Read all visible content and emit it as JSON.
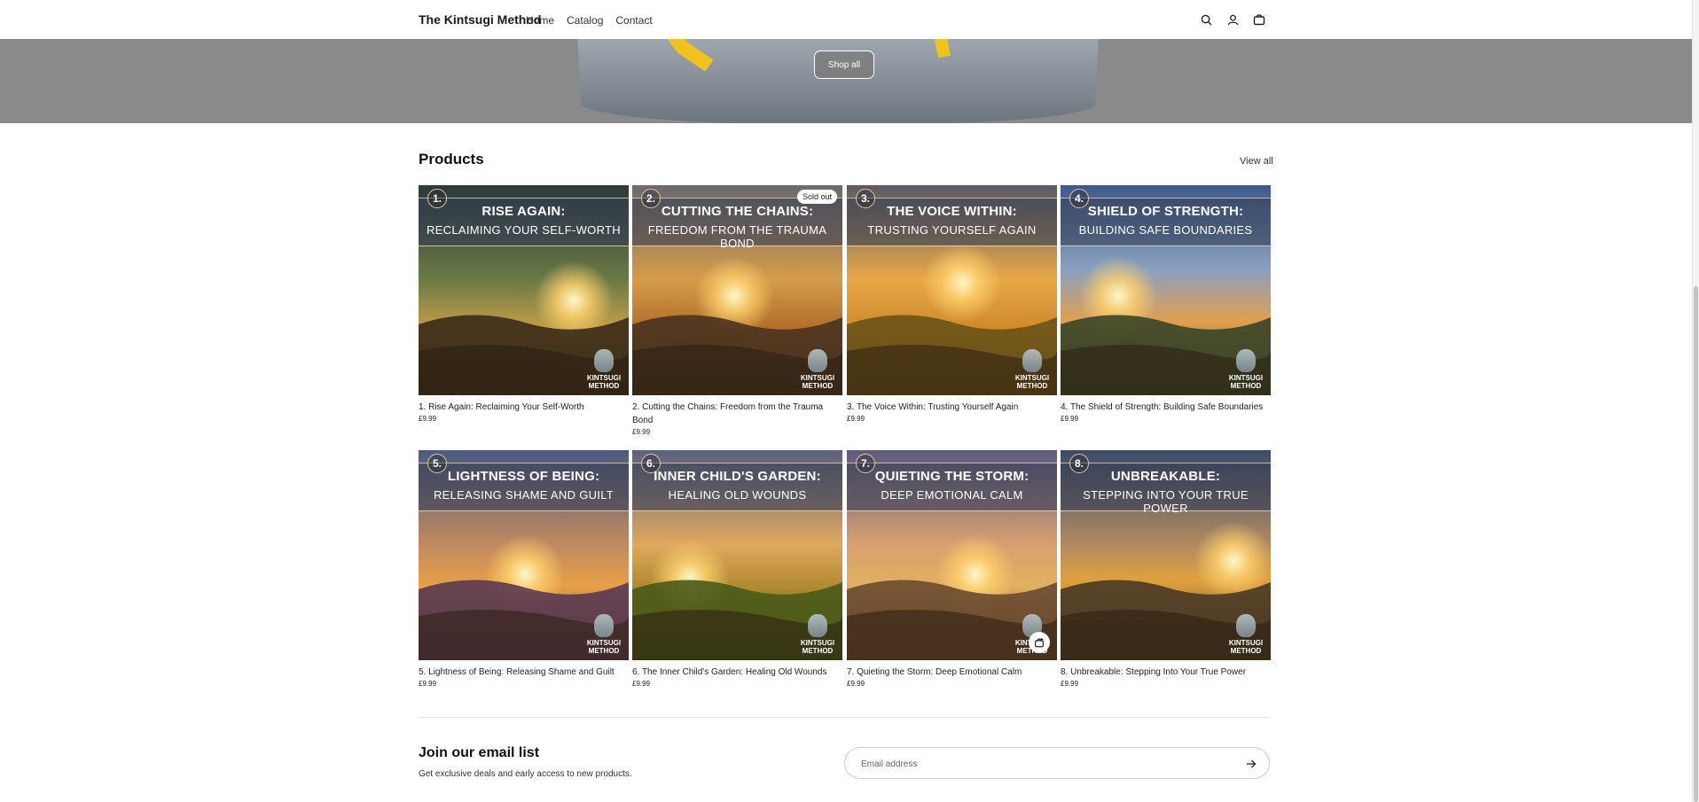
{
  "header": {
    "brand": "The Kintsugi Method",
    "nav": [
      "Home",
      "Catalog",
      "Contact"
    ]
  },
  "hero": {
    "button_label": "Shop all"
  },
  "products": {
    "title": "Products",
    "view_all": "View all",
    "logo_text": [
      "KINTSUGI",
      "METHOD"
    ],
    "items": [
      {
        "num": "1.",
        "line1": "RISE AGAIN:",
        "line2": "RECLAIMING YOUR SELF-WORTH",
        "title": "1. Rise Again: Reclaiming Your Self-Worth",
        "price": "£9.99",
        "badge": ""
      },
      {
        "num": "2.",
        "line1": "CUTTING THE CHAINS:",
        "line2": "FREEDOM FROM THE TRAUMA BOND",
        "title": "2. Cutting the Chains: Freedom from the Trauma Bond",
        "price": "£9.99",
        "badge": "Sold out"
      },
      {
        "num": "3.",
        "line1": "THE VOICE WITHIN:",
        "line2": "TRUSTING YOURSELF AGAIN",
        "title": "3. The Voice Within: Trusting Yourself Again",
        "price": "£9.99",
        "badge": ""
      },
      {
        "num": "4.",
        "line1": "SHIELD OF STRENGTH:",
        "line2": "BUILDING SAFE BOUNDARIES",
        "title": "4. The Shield of Strength: Building Safe Boundaries",
        "price": "£9.99",
        "badge": ""
      },
      {
        "num": "5.",
        "line1": "LIGHTNESS OF BEING:",
        "line2": "RELEASING SHAME AND GUILT",
        "title": "5. Lightness of Being: Releasing Shame and Guilt",
        "price": "£9.99",
        "badge": ""
      },
      {
        "num": "6.",
        "line1": "INNER CHILD'S GARDEN:",
        "line2": "HEALING OLD WOUNDS",
        "title": "6. The Inner Child's Garden: Healing Old Wounds",
        "price": "£9.99",
        "badge": ""
      },
      {
        "num": "7.",
        "line1": "QUIETING THE STORM:",
        "line2": "DEEP EMOTIONAL CALM",
        "title": "7. Quieting the Storm: Deep Emotional Calm",
        "price": "£9.99",
        "badge": ""
      },
      {
        "num": "8.",
        "line1": "UNBREAKABLE:",
        "line2": "STEPPING INTO YOUR TRUE POWER",
        "title": "8. Unbreakable: Stepping Into Your True Power",
        "price": "£9.99",
        "badge": ""
      }
    ]
  },
  "newsletter": {
    "title": "Join our email list",
    "subtitle": "Get exclusive deals and early access to new products.",
    "placeholder": "Email address"
  },
  "icons": [
    "search-icon",
    "account-icon",
    "cart-icon",
    "arrow-right-icon",
    "add-to-cart-icon"
  ]
}
